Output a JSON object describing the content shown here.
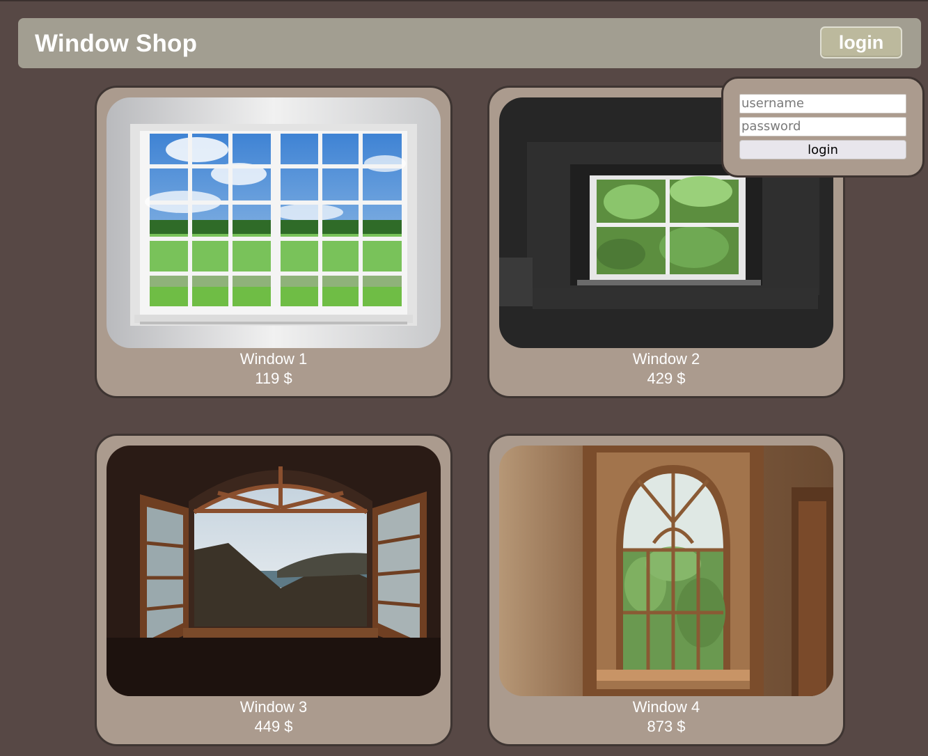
{
  "header": {
    "title": "Window Shop",
    "login_label": "login"
  },
  "login_form": {
    "username_placeholder": "username",
    "password_placeholder": "password",
    "submit_label": "login"
  },
  "products": [
    {
      "name": "Window 1",
      "price": "119 $"
    },
    {
      "name": "Window 2",
      "price": "429 $"
    },
    {
      "name": "Window 3",
      "price": "449 $"
    },
    {
      "name": "Window 4",
      "price": "873 $"
    }
  ],
  "colors": {
    "page_background": "#574845",
    "header_background": "#a29e91",
    "card_background": "#ab9b8e",
    "login_button": "#bcb99d"
  }
}
